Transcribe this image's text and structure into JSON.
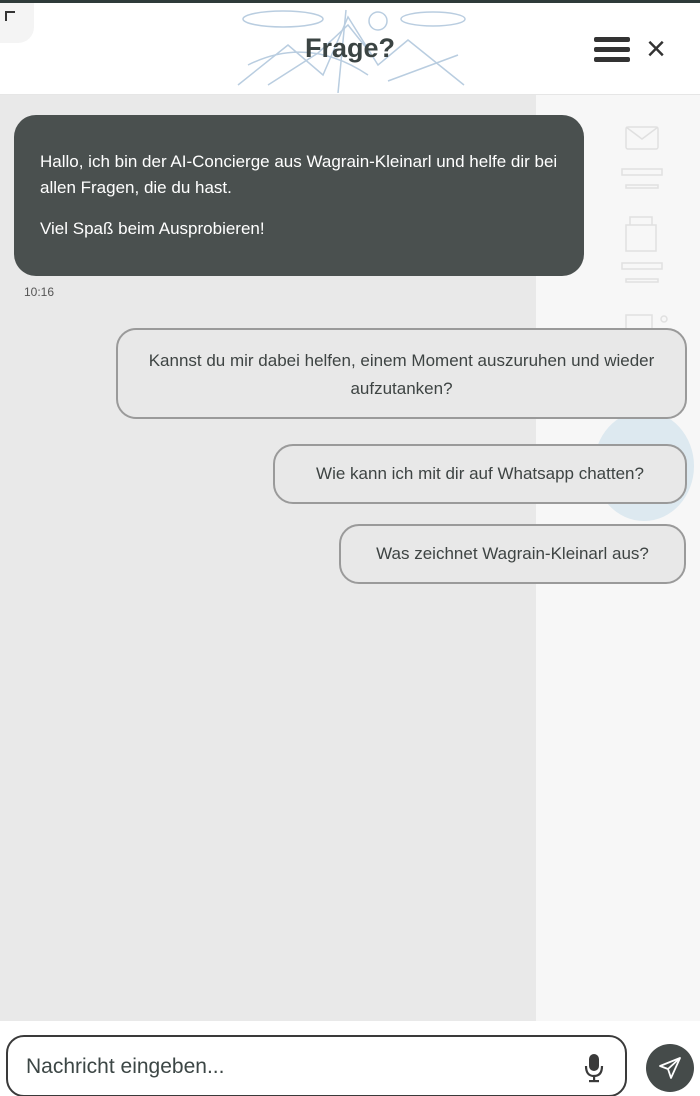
{
  "header": {
    "title": "Frage?",
    "menu_icon": "hamburger-menu-icon",
    "close_icon": "close-icon",
    "close_glyph": "×"
  },
  "messages": [
    {
      "sender": "bot",
      "paragraphs": [
        "Hallo, ich bin der AI-Concierge aus Wagrain-Kleinarl und helfe dir bei allen Fragen, die du hast.",
        "Viel Spaß beim Ausprobieren!"
      ],
      "time": "10:16"
    }
  ],
  "suggestions": [
    "Kannst du mir dabei helfen, einem Moment auszuruhen und wieder aufzutanken?",
    "Wie kann ich mit dir auf Whatsapp chatten?",
    "Was zeichnet Wagrain-Kleinarl aus?"
  ],
  "input": {
    "placeholder": "Nachricht eingeben...",
    "value": "",
    "mic_icon": "microphone-icon",
    "send_icon": "send-icon"
  },
  "colors": {
    "bot_bubble": "#4a504f",
    "chat_background": "#e9e9e9",
    "suggestion_border": "#9a9a9a",
    "send_button": "#454b4a",
    "title": "#3b4443"
  }
}
